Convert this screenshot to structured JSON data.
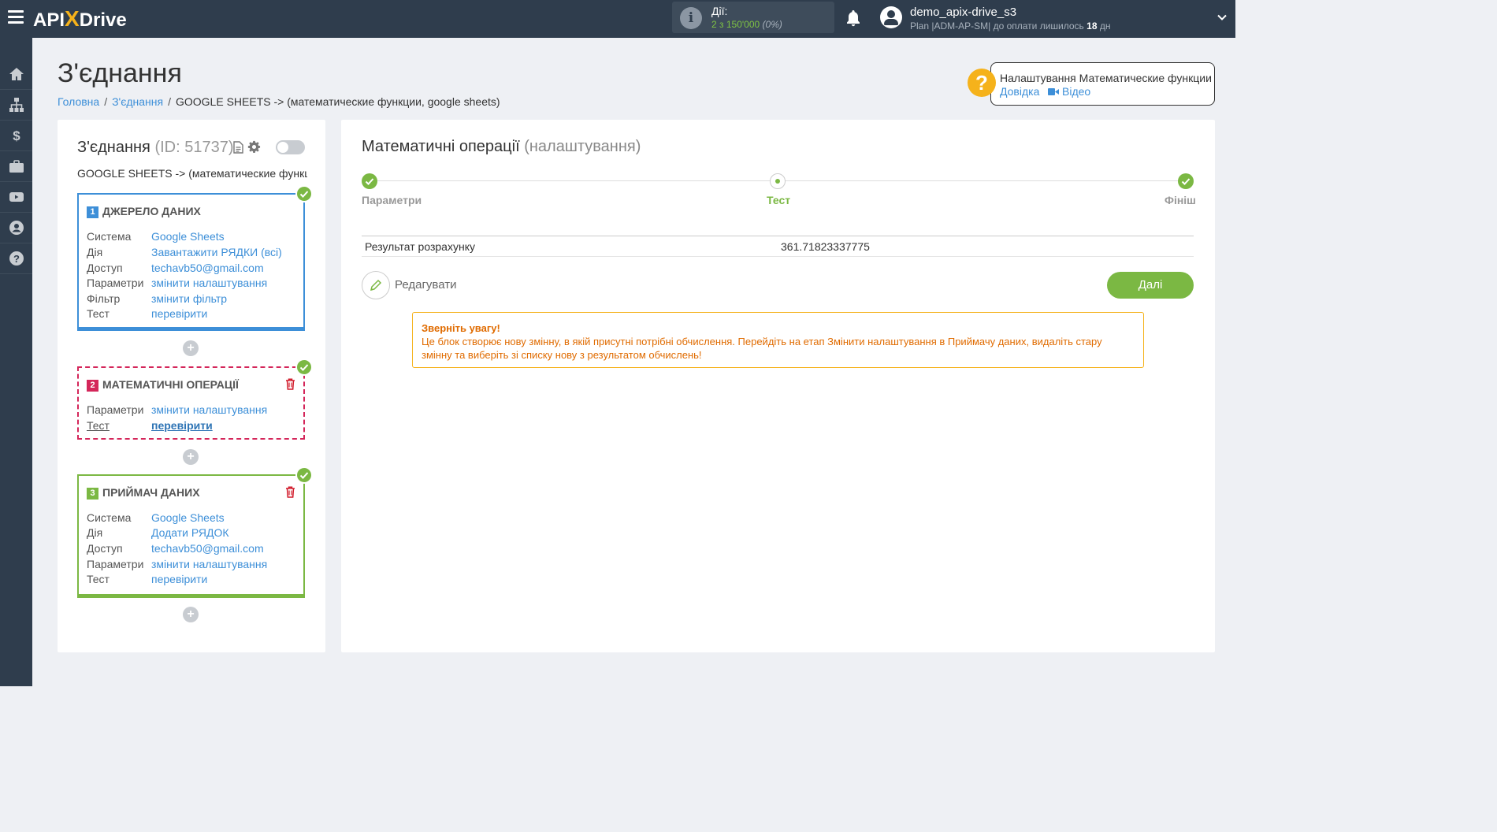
{
  "app": {
    "logo_api": "API",
    "logo_x": "X",
    "logo_drive": "Drive"
  },
  "topbar": {
    "actions_label": "Дії:",
    "actions_value": "2 з 150'000",
    "actions_pct": "(0%)",
    "username": "demo_apix-drive_s3",
    "plan_text": "Plan |ADM-AP-SM| до оплати лишилось",
    "plan_days": "18",
    "plan_unit": "дн"
  },
  "sidebar": {
    "items": [
      "home-icon",
      "sitemap-icon",
      "dollar-icon",
      "briefcase-icon",
      "youtube-icon",
      "user-icon",
      "question-icon"
    ]
  },
  "header": {
    "title": "З'єднання",
    "breadcrumb": {
      "home": "Головна",
      "connections": "З'єднання",
      "current": "GOOGLE SHEETS -> (математические функции, google sheets)"
    }
  },
  "help": {
    "title": "Налаштування Математические функции",
    "docs": "Довідка",
    "video": "Відео"
  },
  "connection": {
    "title": "З'єднання",
    "id_text": "(ID: 51737)",
    "subtitle": "GOOGLE SHEETS -> (математические функции"
  },
  "blocks": {
    "source": {
      "number": "1",
      "title": "ДЖЕРЕЛО ДАНИХ",
      "rows": [
        {
          "k": "Система",
          "v": "Google Sheets"
        },
        {
          "k": "Дія",
          "v": "Завантажити РЯДКИ (всі)"
        },
        {
          "k": "Доступ",
          "v": "techavb50@gmail.com"
        },
        {
          "k": "Параметри",
          "v": "змінити налаштування"
        },
        {
          "k": "Фільтр",
          "v": "змінити фільтр"
        },
        {
          "k": "Тест",
          "v": "перевірити"
        }
      ]
    },
    "math": {
      "number": "2",
      "title": "МАТЕМАТИЧНІ ОПЕРАЦІЇ",
      "rows": [
        {
          "k": "Параметри",
          "v": "змінити налаштування"
        },
        {
          "k": "Тест",
          "v": "перевірити"
        }
      ]
    },
    "receiver": {
      "number": "3",
      "title": "ПРИЙМАЧ ДАНИХ",
      "rows": [
        {
          "k": "Система",
          "v": "Google Sheets"
        },
        {
          "k": "Дія",
          "v": "Додати РЯДОК"
        },
        {
          "k": "Доступ",
          "v": "techavb50@gmail.com"
        },
        {
          "k": "Параметри",
          "v": "змінити налаштування"
        },
        {
          "k": "Тест",
          "v": "перевірити"
        }
      ]
    },
    "plus": "+"
  },
  "main": {
    "title": "Математичні операції",
    "title_muted": "(налаштування)",
    "steps": [
      "Параметри",
      "Тест",
      "Фініш"
    ],
    "result_label": "Результат розрахунку",
    "result_value": "361.71823337775",
    "edit_label": "Редагувати",
    "next_label": "Далі",
    "warning_title": "Зверніть увагу!",
    "warning_text": "Це блок створює нову змінну, в якій присутні потрібні обчислення. Перейдіть на етап Змінити налаштування в Приймачу даних, видаліть стару змінну та виберіть зі списку нову з результатом обчислень!"
  },
  "colors": {
    "topbar": "#2f3d4d",
    "accent_blue": "#3d8fd8",
    "accent_green": "#7bb843",
    "accent_red": "#d4265a",
    "accent_yellow": "#f5b21b",
    "warning_text": "#e06b00"
  }
}
